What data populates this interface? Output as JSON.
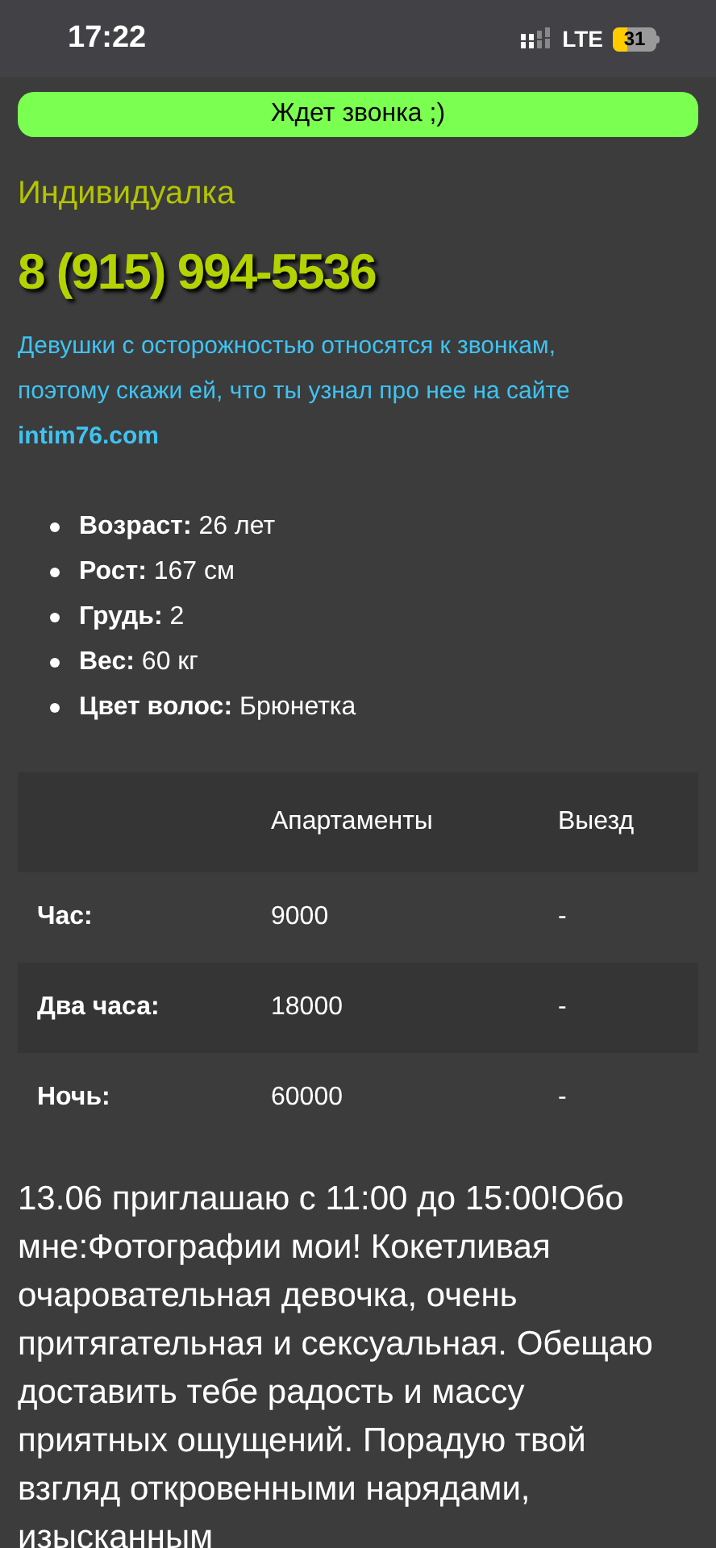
{
  "status_bar": {
    "time": "17:22",
    "network": "LTE",
    "battery": "31"
  },
  "status_banner": "Ждет звонка ;)",
  "category": "Индивидуалка",
  "phone": "8 (915) 994-5536",
  "notice": {
    "text": "Девушки с осторожностью относятся к звонкам, поэтому скажи ей, что ты узнал про нее на сайте",
    "site": "intim76.com"
  },
  "params": [
    {
      "label": "Возраст:",
      "value": "26 лет"
    },
    {
      "label": "Рост:",
      "value": "167 см"
    },
    {
      "label": "Грудь:",
      "value": "2"
    },
    {
      "label": "Вес:",
      "value": "60 кг"
    },
    {
      "label": "Цвет волос:",
      "value": "Брюнетка"
    }
  ],
  "prices": {
    "columns": [
      "Апартаменты",
      "Выезд"
    ],
    "rows": [
      {
        "label": "Час:",
        "cells": [
          "9000",
          "-"
        ]
      },
      {
        "label": "Два часа:",
        "cells": [
          "18000",
          "-"
        ]
      },
      {
        "label": "Ночь:",
        "cells": [
          "60000",
          "-"
        ]
      }
    ]
  },
  "description": "13.06 приглашаю с 11:00 до 15:00!Обо мне:Фотографии мои! Кокетливая очаровательная девочка, очень притягательная и сексуальная. Обещаю доставить тебе радость и массу приятных ощущений. Порадую твой взгляд откровенными нарядами, изысканным"
}
